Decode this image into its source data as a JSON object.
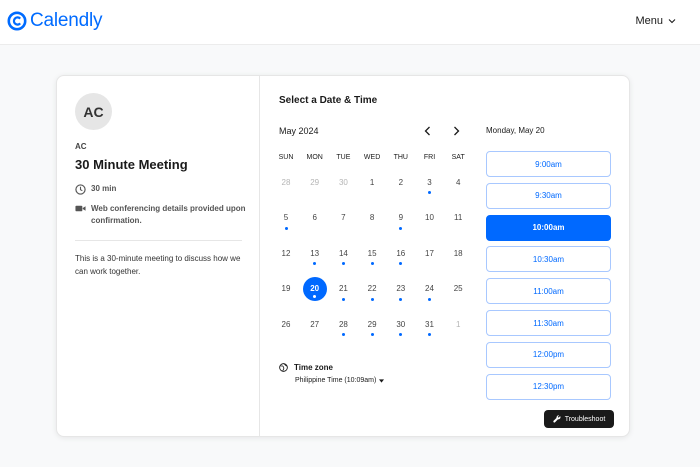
{
  "brand": {
    "name": "Calendly",
    "color": "#006bff"
  },
  "header": {
    "menu_label": "Menu"
  },
  "event": {
    "avatar_initials": "AC",
    "host": "AC",
    "title": "30 Minute Meeting",
    "duration": "30 min",
    "location_note": "Web conferencing details provided upon confirmation.",
    "description": "This is a 30-minute meeting to discuss how we can work together."
  },
  "calendar": {
    "heading": "Select a Date & Time",
    "month": "May 2024",
    "weekdays": [
      "SUN",
      "MON",
      "TUE",
      "WED",
      "THU",
      "FRI",
      "SAT"
    ],
    "selected_day": "20",
    "weeks": [
      [
        {
          "d": "28",
          "muted": true
        },
        {
          "d": "29",
          "muted": true
        },
        {
          "d": "30",
          "muted": true
        },
        {
          "d": "1"
        },
        {
          "d": "2"
        },
        {
          "d": "3",
          "avail": true
        },
        {
          "d": "4"
        }
      ],
      [
        {
          "d": "5",
          "avail": true
        },
        {
          "d": "6"
        },
        {
          "d": "7"
        },
        {
          "d": "8"
        },
        {
          "d": "9",
          "avail": true
        },
        {
          "d": "10"
        },
        {
          "d": "11"
        }
      ],
      [
        {
          "d": "12"
        },
        {
          "d": "13",
          "avail": true
        },
        {
          "d": "14",
          "avail": true
        },
        {
          "d": "15",
          "avail": true
        },
        {
          "d": "16",
          "avail": true
        },
        {
          "d": "17"
        },
        {
          "d": "18"
        }
      ],
      [
        {
          "d": "19"
        },
        {
          "d": "20",
          "avail": true,
          "selected": true
        },
        {
          "d": "21",
          "avail": true
        },
        {
          "d": "22",
          "avail": true
        },
        {
          "d": "23",
          "avail": true
        },
        {
          "d": "24",
          "avail": true
        },
        {
          "d": "25"
        }
      ],
      [
        {
          "d": "26"
        },
        {
          "d": "27"
        },
        {
          "d": "28",
          "avail": true
        },
        {
          "d": "29",
          "avail": true
        },
        {
          "d": "30",
          "avail": true
        },
        {
          "d": "31",
          "avail": true
        },
        {
          "d": "1",
          "muted": true
        }
      ]
    ],
    "timezone_label": "Time zone",
    "timezone_value": "Philippine Time (10:09am)"
  },
  "times": {
    "date_label": "Monday, May 20",
    "slots": [
      "9:00am",
      "9:30am",
      "10:00am",
      "10:30am",
      "11:00am",
      "11:30am",
      "12:00pm",
      "12:30pm"
    ],
    "active_slot": "10:00am"
  },
  "troubleshoot_label": "Troubleshoot",
  "icons": {
    "logo": "calendly-logo-icon",
    "menu": "chevron-down-icon",
    "clock": "clock-icon",
    "video": "video-camera-icon",
    "globe": "globe-icon",
    "wrench": "wrench-icon"
  }
}
